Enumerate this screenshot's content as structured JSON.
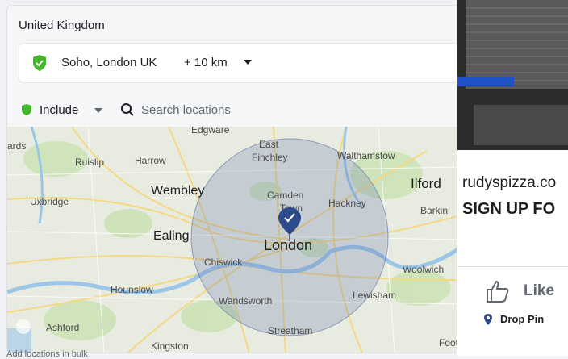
{
  "location": {
    "country": "United Kingdom",
    "selected_name": "Soho, London UK",
    "radius": "+ 10 km"
  },
  "filter": {
    "include_label": "Include",
    "search_placeholder": "Search locations"
  },
  "map": {
    "places": [
      "Edgware",
      "ards",
      "Ruislip",
      "Harrow",
      "East",
      "Finchley",
      "Walthamstow",
      "Ilford",
      "Wembley",
      "Uxbridge",
      "Camden",
      "Town",
      "Hackney",
      "Barkin",
      "Ealing",
      "London",
      "Chiswick",
      "Woolwich",
      "Hounslow",
      "Wandsworth",
      "Lewisham",
      "Ashford",
      "Streatham",
      "Kingston",
      "Foots Cray"
    ],
    "radius_color": "#5b6fa6",
    "pin_color": "#2d4a8a"
  },
  "add_bulk_label": "Add locations in bulk",
  "ad": {
    "domain": "rudyspizza.co",
    "cta": "SIGN UP FO",
    "like_label": "Like",
    "drop_pin_label": "Drop Pin"
  },
  "colors": {
    "include_green": "#42b72a",
    "accent_blue": "#1877f2"
  }
}
